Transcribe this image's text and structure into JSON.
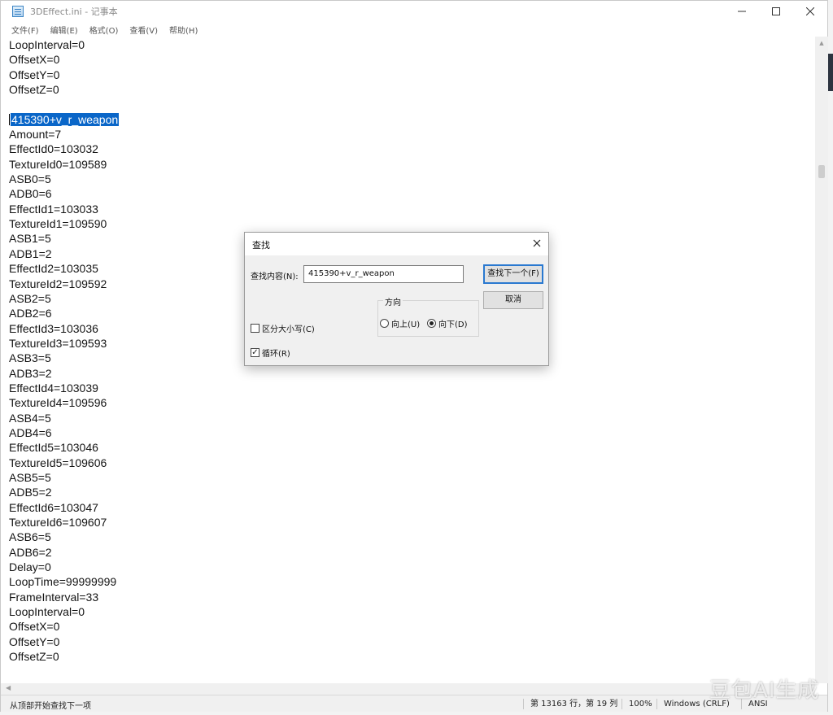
{
  "window": {
    "title": "3DEffect.ini - 记事本"
  },
  "menu": [
    {
      "label": "文件(F)"
    },
    {
      "label": "编辑(E)"
    },
    {
      "label": "格式(O)"
    },
    {
      "label": "查看(V)"
    },
    {
      "label": "帮助(H)"
    }
  ],
  "editor": {
    "lines_before": [
      "LoopInterval=0",
      "OffsetX=0",
      "OffsetY=0",
      "OffsetZ=0",
      ""
    ],
    "selected_line": "415390+v_r_weapon",
    "lines_after": [
      "Amount=7",
      "EffectId0=103032",
      "TextureId0=109589",
      "ASB0=5",
      "ADB0=6",
      "EffectId1=103033",
      "TextureId1=109590",
      "ASB1=5",
      "ADB1=2",
      "EffectId2=103035",
      "TextureId2=109592",
      "ASB2=5",
      "ADB2=6",
      "EffectId3=103036",
      "TextureId3=109593",
      "ASB3=5",
      "ADB3=2",
      "EffectId4=103039",
      "TextureId4=109596",
      "ASB4=5",
      "ADB4=6",
      "EffectId5=103046",
      "TextureId5=109606",
      "ASB5=5",
      "ADB5=2",
      "EffectId6=103047",
      "TextureId6=109607",
      "ASB6=5",
      "ADB6=2",
      "Delay=0",
      "LoopTime=99999999",
      "FrameInterval=33",
      "LoopInterval=0",
      "OffsetX=0",
      "OffsetY=0",
      "OffsetZ=0"
    ]
  },
  "status": {
    "message": "从顶部开始查找下一项",
    "position": "第 13163 行，第 19 列",
    "zoom": "100%",
    "line_ending": "Windows (CRLF)",
    "encoding": "ANSI"
  },
  "find_dialog": {
    "title": "查找",
    "find_label": "查找内容(N):",
    "find_value": "415390+v_r_weapon",
    "find_next_label": "查找下一个(F)",
    "cancel_label": "取消",
    "direction_label": "方向",
    "up_label": "向上(U)",
    "down_label": "向下(D)",
    "direction_selected": "down",
    "match_case_label": "区分大小写(C)",
    "match_case_checked": false,
    "wrap_label": "循环(R)",
    "wrap_checked": true
  },
  "watermark": {
    "text": "豆包AI生成"
  }
}
